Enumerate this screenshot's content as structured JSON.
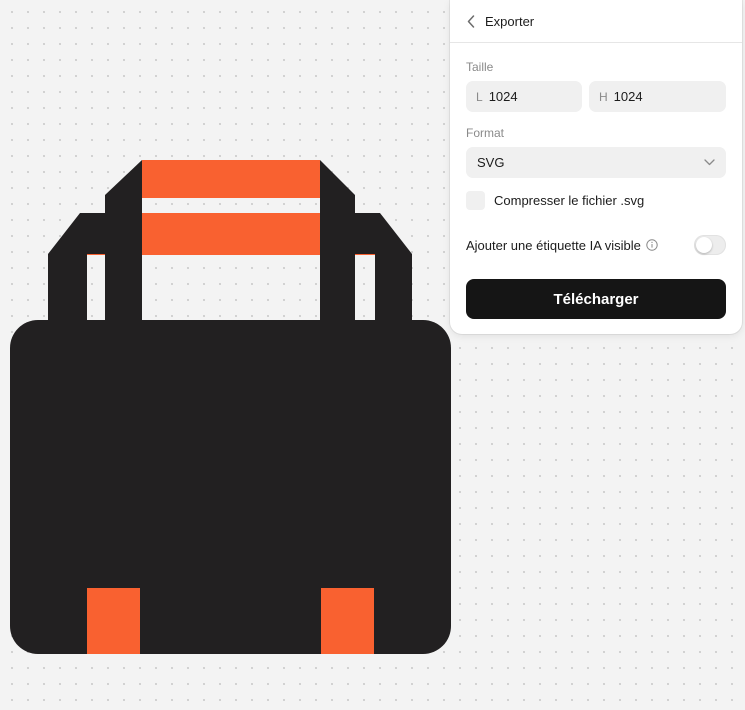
{
  "export_panel": {
    "title": "Exporter",
    "size_label": "Taille",
    "width_prefix": "L",
    "width_value": "1024",
    "height_prefix": "H",
    "height_value": "1024",
    "format_label": "Format",
    "format_selected": "SVG",
    "compress_label": "Compresser le fichier .svg",
    "compress_checked": false,
    "ai_label_text": "Ajouter une étiquette IA visible",
    "ai_label_enabled": false,
    "download_label": "Télécharger"
  },
  "icons": {
    "back": "chevron-left-icon",
    "format_dropdown": "chevron-down-icon",
    "info": "info-icon"
  },
  "colors": {
    "artwork_dark": "#222021",
    "artwork_accent": "#f96130",
    "button_bg": "#151515"
  }
}
